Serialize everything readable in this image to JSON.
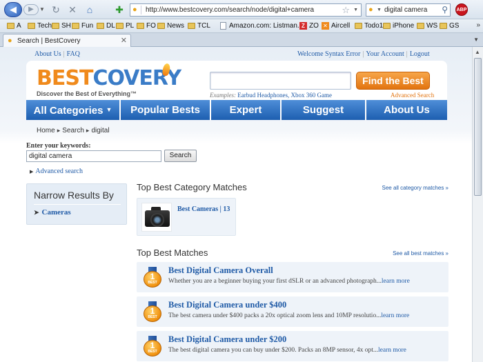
{
  "browser": {
    "url": "http://www.bestcovery.com/search/node/digital+camera",
    "search_value": "digital camera",
    "abp_label": "ABP",
    "bookmarks": [
      {
        "label": "A",
        "type": "folder"
      },
      {
        "label": "Tech",
        "type": "folder"
      },
      {
        "label": "SH",
        "type": "folder"
      },
      {
        "label": "Fun",
        "type": "folder"
      },
      {
        "label": "DL",
        "type": "folder"
      },
      {
        "label": "PL",
        "type": "folder"
      },
      {
        "label": "FO",
        "type": "folder"
      },
      {
        "label": "News",
        "type": "folder"
      },
      {
        "label": "TCL",
        "type": "folder"
      },
      {
        "label": "Amazon.com: Listman...",
        "type": "page"
      },
      {
        "label": "ZO",
        "type": "zo"
      },
      {
        "label": "Aircell",
        "type": "ac"
      },
      {
        "label": "Todo1",
        "type": "folder"
      },
      {
        "label": "iPhone",
        "type": "folder"
      },
      {
        "label": "WS",
        "type": "folder"
      },
      {
        "label": "GS",
        "type": "folder"
      }
    ],
    "bookmarks_more": "»",
    "tab_title": "Search | BestCovery"
  },
  "site": {
    "top_links_left": [
      "About Us",
      "FAQ"
    ],
    "top_links_right": [
      "Welcome Syntax Error",
      "Your Account",
      "Logout"
    ],
    "logo_best": "BEST",
    "logo_covery": "COVERY",
    "tagline": "Discover the Best of Everything™",
    "find_button": "Find the Best",
    "examples_label": "Examples:",
    "examples": "Earbud Headphones, Xbox 360 Game",
    "advanced_search_top": "Advanced Search",
    "nav": [
      "All Categories",
      "Popular Bests",
      "Expert",
      "Suggest",
      "About Us"
    ],
    "breadcrumb": [
      "Home",
      "Search",
      "digital"
    ]
  },
  "search": {
    "label": "Enter your keywords:",
    "value": "digital camera",
    "button": "Search",
    "advanced": "Advanced search"
  },
  "narrow": {
    "title": "Narrow Results By",
    "items": [
      "Cameras"
    ]
  },
  "category_section": {
    "title": "Top Best Category Matches",
    "see_all": "See all category matches »",
    "cards": [
      {
        "label": "Best Cameras | 13"
      }
    ]
  },
  "matches_section": {
    "title": "Top Best Matches",
    "see_all": "See all best matches »",
    "medal_number": "1",
    "medal_text": "BEST",
    "more_label": "learn more",
    "items": [
      {
        "title": "Best Digital Camera Overall",
        "desc": "Whether you are a beginner buying your first dSLR or an advanced photograph..."
      },
      {
        "title": "Best Digital Camera under $400",
        "desc": "The best camera under $400 packs a 20x optical zoom lens and 10MP resolutio..."
      },
      {
        "title": "Best Digital Camera under $200",
        "desc": "The best digital camera you can buy under $200. Packs an 8MP sensor, 4x opt..."
      }
    ]
  }
}
